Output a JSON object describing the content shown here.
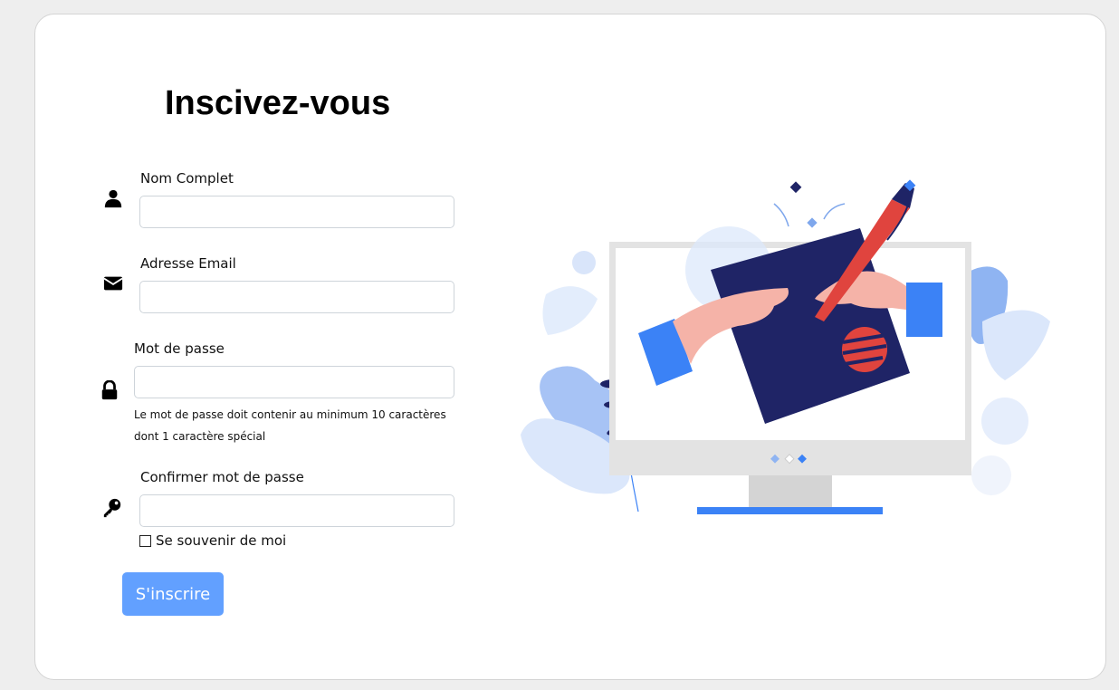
{
  "form": {
    "title": "Inscivez-vous",
    "fields": [
      {
        "label": "Nom Complet",
        "value": "",
        "icon": "user-icon"
      },
      {
        "label": "Adresse Email",
        "value": "",
        "icon": "envelope-icon"
      },
      {
        "label": "Mot de passe",
        "value": "",
        "icon": "lock-icon",
        "help_line1": "Le mot de passe doit contenir au minimum 10 caractères",
        "help_line2": "dont 1 caractère spécial"
      },
      {
        "label": "Confirmer mot de passe",
        "value": "",
        "icon": "key-icon"
      }
    ],
    "remember_label": "Se souvenir de moi",
    "remember_checked": false,
    "submit_label": "S'inscrire"
  },
  "illustration": {
    "name": "signup-illustration"
  },
  "colors": {
    "primary": "#62a0ff",
    "navy": "#1f2466",
    "accent_red": "#e0443e",
    "blue": "#3b82f6"
  }
}
